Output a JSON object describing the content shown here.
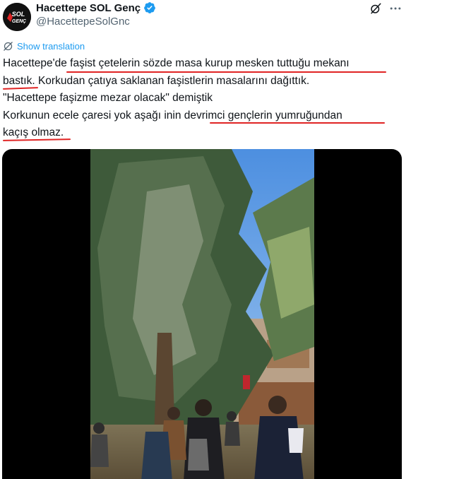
{
  "author": {
    "display_name": "Hacettepe SOL Genç",
    "handle": "@HacettepeSolGnc",
    "avatar_text": "SOL GENÇ",
    "verified": true,
    "avatar_icon": "sol-genc-logo",
    "verified_icon": "verified-badge-icon"
  },
  "actions": {
    "grok_icon": "grok-icon",
    "more_icon": "more-options-icon"
  },
  "translation": {
    "link_text": "Show translation",
    "icon": "globe-icon"
  },
  "tweet": {
    "lines": [
      "Hacettepe'de faşist çetelerin sözde masa kurup mesken tuttuğu mekanı",
      "bastık. Korkudan çatıya saklanan faşistlerin masalarını dağıttık.",
      "\"Hacettepe faşizme mezar olacak\"  demiştik",
      "Korkunun ecele çaresi yok aşağı inin devrimci gençlerin yumruğundan",
      "kaçış olmaz."
    ]
  },
  "media": {
    "type": "video",
    "description_icon": "video-thumbnail"
  },
  "colors": {
    "accent": "#1d9bf0",
    "annotation_red": "#e02424",
    "text": "#0f1419",
    "secondary_text": "#536471"
  }
}
